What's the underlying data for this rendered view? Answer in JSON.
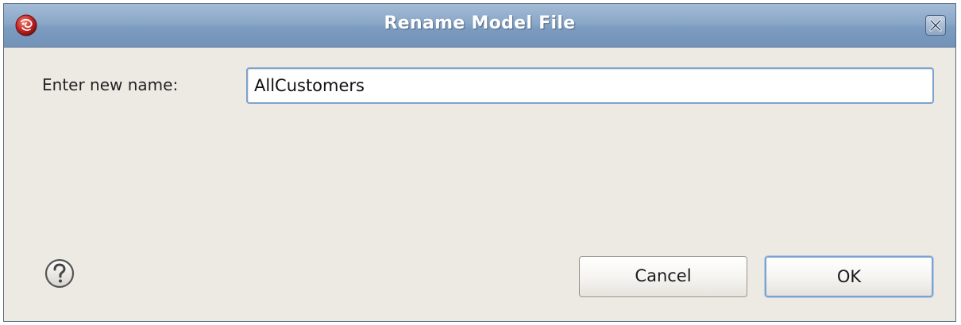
{
  "window": {
    "title": "Rename Model File"
  },
  "icons": {
    "app": "app-logo-icon",
    "close": "close-icon",
    "help": "help-question-icon"
  },
  "form": {
    "label": "Enter new name:",
    "value": "AllCustomers"
  },
  "buttons": {
    "cancel_label": "Cancel",
    "ok_label": "OK"
  },
  "colors": {
    "titlebar": "#8aa7c8",
    "dialog_bg": "#edeae4",
    "focus_border": "#7da2ce",
    "app_icon": "#c62828"
  }
}
